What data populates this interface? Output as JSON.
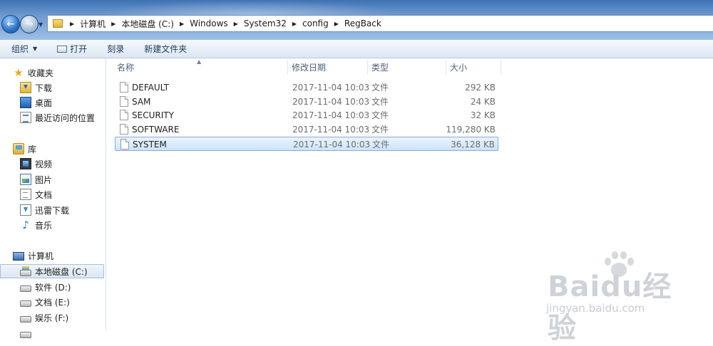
{
  "address": {
    "crumbs": [
      "计算机",
      "本地磁盘 (C:)",
      "Windows",
      "System32",
      "config",
      "RegBack"
    ]
  },
  "toolbar": {
    "organize": "组织",
    "open": "打开",
    "burn": "刻录",
    "new_folder": "新建文件夹"
  },
  "nav": {
    "favorites": "收藏夹",
    "downloads": "下载",
    "desktop": "桌面",
    "recent": "最近访问的位置",
    "libraries": "库",
    "videos": "视频",
    "pictures": "图片",
    "documents": "文档",
    "thunder": "迅雷下载",
    "music": "音乐",
    "computer": "计算机",
    "drive_c": "本地磁盘 (C:)",
    "drive_d": "软件 (D:)",
    "drive_e": "文档 (E:)",
    "drive_f": "娱乐 (F:)"
  },
  "columns": {
    "name": "名称",
    "date": "修改日期",
    "type": "类型",
    "size": "大小"
  },
  "files": [
    {
      "name": "DEFAULT",
      "date": "2017-11-04 10:03",
      "type": "文件",
      "size": "292 KB"
    },
    {
      "name": "SAM",
      "date": "2017-11-04 10:03",
      "type": "文件",
      "size": "24 KB"
    },
    {
      "name": "SECURITY",
      "date": "2017-11-04 10:03",
      "type": "文件",
      "size": "32 KB"
    },
    {
      "name": "SOFTWARE",
      "date": "2017-11-04 10:03",
      "type": "文件",
      "size": "119,280 KB"
    },
    {
      "name": "SYSTEM",
      "date": "2017-11-04 10:03",
      "type": "文件",
      "size": "36,128 KB"
    }
  ],
  "watermark": {
    "brand": "Baidu经验",
    "url": "jingyan.baidu.com"
  }
}
